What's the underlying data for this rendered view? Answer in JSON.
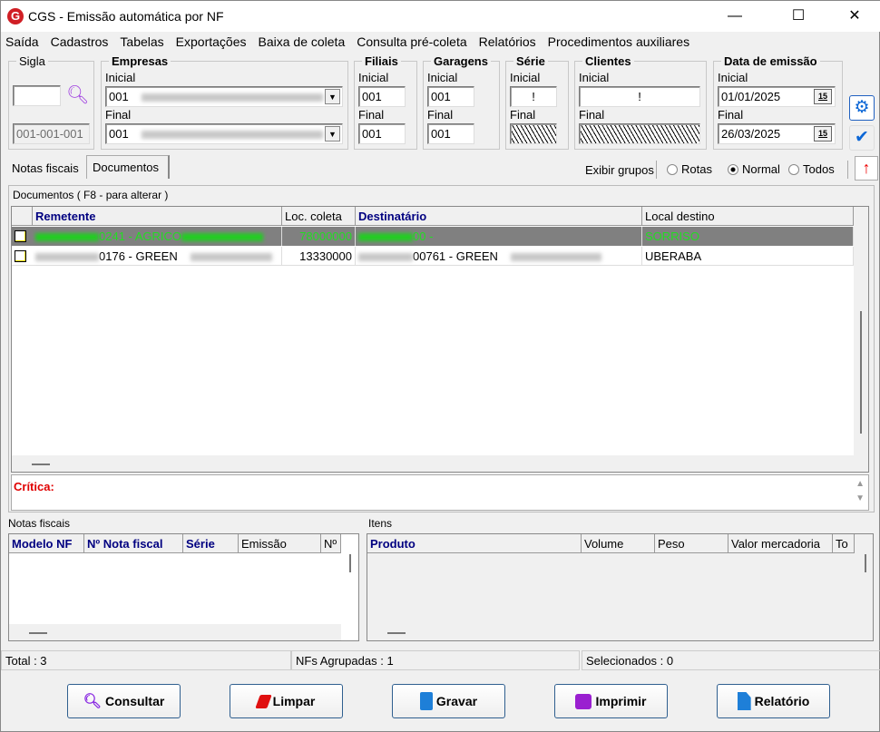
{
  "window": {
    "title": "CGS - Emissão automática por NF",
    "minimize": "—",
    "maximize": "☐",
    "close": "✕",
    "logo": "G"
  },
  "menu": [
    "Saída",
    "Cadastros",
    "Tabelas",
    "Exportações",
    "Baixa de coleta",
    "Consulta pré-coleta",
    "Relatórios",
    "Procedimentos auxiliares"
  ],
  "filters": {
    "sigla": {
      "label": "Sigla",
      "value": "",
      "code": "001-001-001"
    },
    "empresas": {
      "label": "Empresas",
      "inicial_label": "Inicial",
      "inicial": "001",
      "final_label": "Final",
      "final": "001"
    },
    "filiais": {
      "label": "Filiais",
      "inicial_label": "Inicial",
      "inicial": "001",
      "final_label": "Final",
      "final": "001"
    },
    "garagens": {
      "label": "Garagens",
      "inicial_label": "Inicial",
      "inicial": "001",
      "final_label": "Final",
      "final": "001"
    },
    "serie": {
      "label": "Série",
      "inicial_label": "Inicial",
      "inicial": "!",
      "final_label": "Final",
      "final": ""
    },
    "clientes": {
      "label": "Clientes",
      "inicial_label": "Inicial",
      "inicial": "!",
      "final_label": "Final",
      "final": ""
    },
    "data": {
      "label": "Data de emissão",
      "inicial_label": "Inicial",
      "inicial": "01/01/2025",
      "final_label": "Final",
      "final": "26/03/2025",
      "cal": "15"
    }
  },
  "tabs": [
    {
      "label": "Notas fiscais",
      "active": false
    },
    {
      "label": "Documentos",
      "active": true
    }
  ],
  "grupos": {
    "label": "Exibir grupos",
    "options": [
      "Rotas",
      "Normal",
      "Todos"
    ],
    "selected": "Normal"
  },
  "documentos": {
    "title": "Documentos ( F8 - para alterar )",
    "columns": [
      "Remetente",
      "Loc. coleta",
      "Destinatário",
      "Local destino"
    ],
    "rows": [
      {
        "remetente": "0241 - AGRICO",
        "loc": "78000000",
        "destinatario": "00 -",
        "local": "SORRISO",
        "selected": true
      },
      {
        "remetente": "0176 - GREEN",
        "loc": "13330000",
        "destinatario": "00761 - GREEN",
        "local": "UBERABA",
        "selected": false
      }
    ],
    "critica": "Crítica:"
  },
  "notas": {
    "title": "Notas fiscais",
    "columns": [
      "Modelo NF",
      "Nº Nota fiscal",
      "Série",
      "Emissão",
      "Nº"
    ]
  },
  "itens": {
    "title": "Itens",
    "columns": [
      "Produto",
      "Volume",
      "Peso",
      "Valor mercadoria",
      "To"
    ]
  },
  "status": {
    "total": "Total : 3",
    "agrupadas": "NFs Agrupadas : 1",
    "selecionados": "Selecionados : 0"
  },
  "buttons": [
    {
      "label": "Consultar",
      "icon": "search-icon",
      "color": "#8a2be2"
    },
    {
      "label": "Limpar",
      "icon": "eraser-icon",
      "color": "#e01010"
    },
    {
      "label": "Gravar",
      "icon": "save-icon",
      "color": "#1e7fd8"
    },
    {
      "label": "Imprimir",
      "icon": "printer-icon",
      "color": "#9a1fd0"
    },
    {
      "label": "Relatório",
      "icon": "document-icon",
      "color": "#1e7fd8"
    }
  ],
  "colors": {
    "selected_row": "#808080",
    "selected_text": "#22dd22",
    "header_blue": "#000080",
    "critica": "#e00000"
  }
}
